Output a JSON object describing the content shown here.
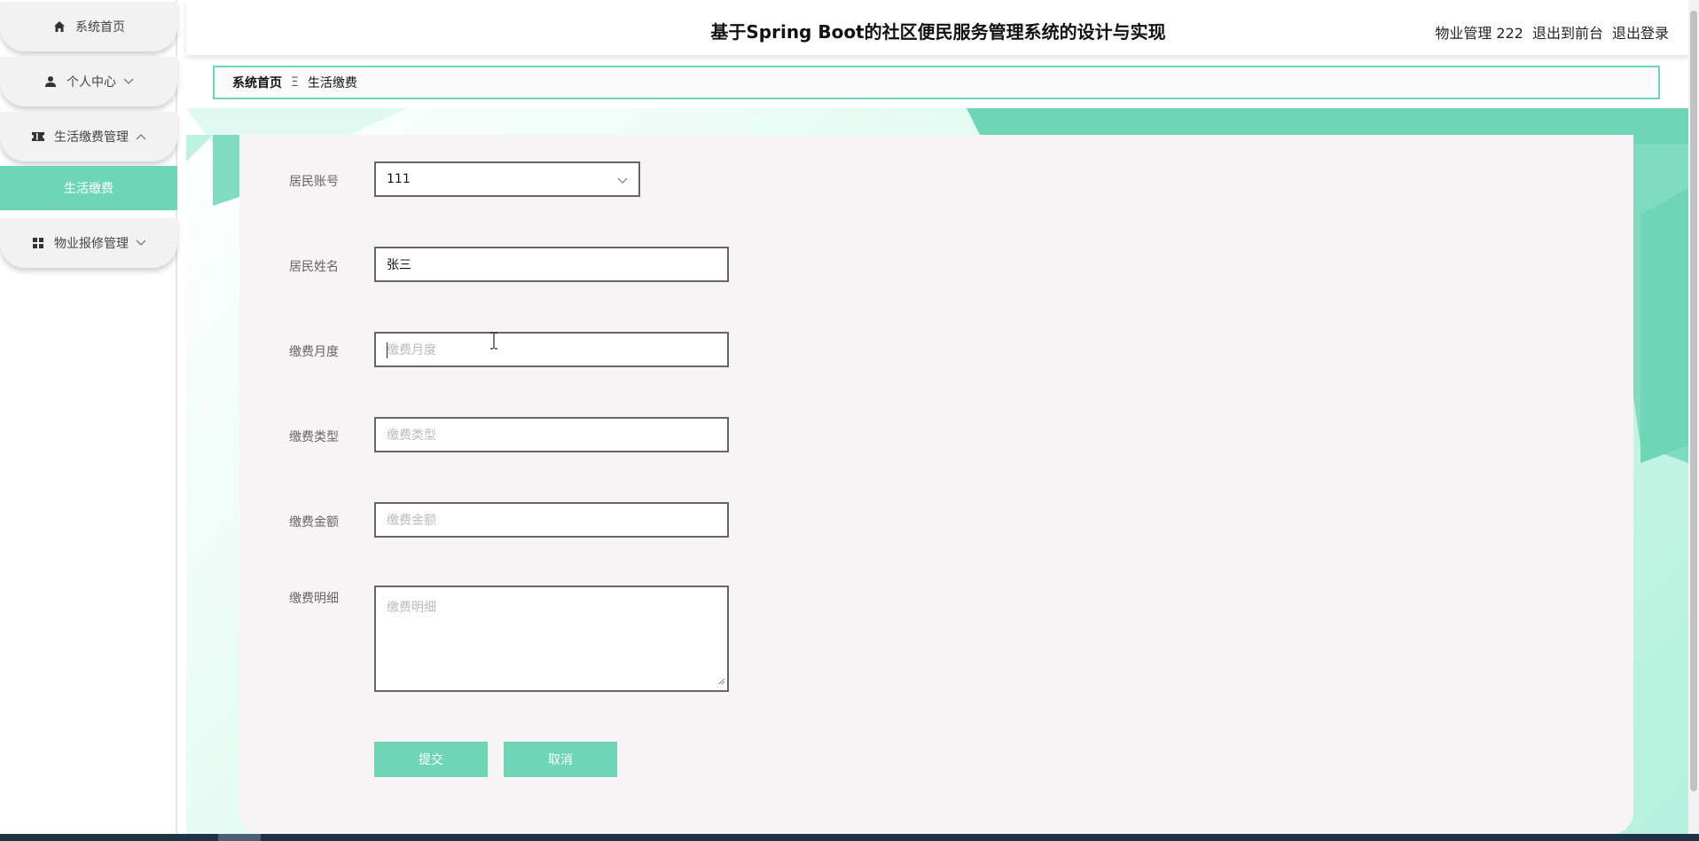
{
  "header": {
    "title": "基于Spring Boot的社区便民服务管理系统的设计与实现",
    "user_label": "物业管理 222",
    "to_front_label": "退出到前台",
    "logout_label": "退出登录"
  },
  "sidebar": {
    "items": [
      {
        "label": "系统首页",
        "icon": "home-icon"
      },
      {
        "label": "个人中心",
        "icon": "user-icon",
        "caret": "chevron-down-icon"
      },
      {
        "label": "生活缴费管理",
        "icon": "ticket-icon",
        "caret": "chevron-up-icon"
      },
      {
        "label": "生活缴费",
        "active": true
      },
      {
        "label": "物业报修管理",
        "icon": "grid-icon",
        "caret": "chevron-down-icon"
      }
    ]
  },
  "breadcrumb": {
    "home": "系统首页",
    "separator": "Ξ",
    "current": "生活缴费"
  },
  "form": {
    "account": {
      "label": "居民账号",
      "value": "111"
    },
    "name": {
      "label": "居民姓名",
      "value": "张三"
    },
    "month": {
      "label": "缴费月度",
      "placeholder": "缴费月度"
    },
    "type": {
      "label": "缴费类型",
      "placeholder": "缴费类型"
    },
    "amount": {
      "label": "缴费金额",
      "placeholder": "缴费金额"
    },
    "detail": {
      "label": "缴费明细",
      "placeholder": "缴费明细"
    },
    "submit_label": "提交",
    "cancel_label": "取消"
  },
  "colors": {
    "accent": "#6fd5b7",
    "sidebar_bg": "#f2f2f2",
    "card_bg": "#f6f4f4"
  }
}
